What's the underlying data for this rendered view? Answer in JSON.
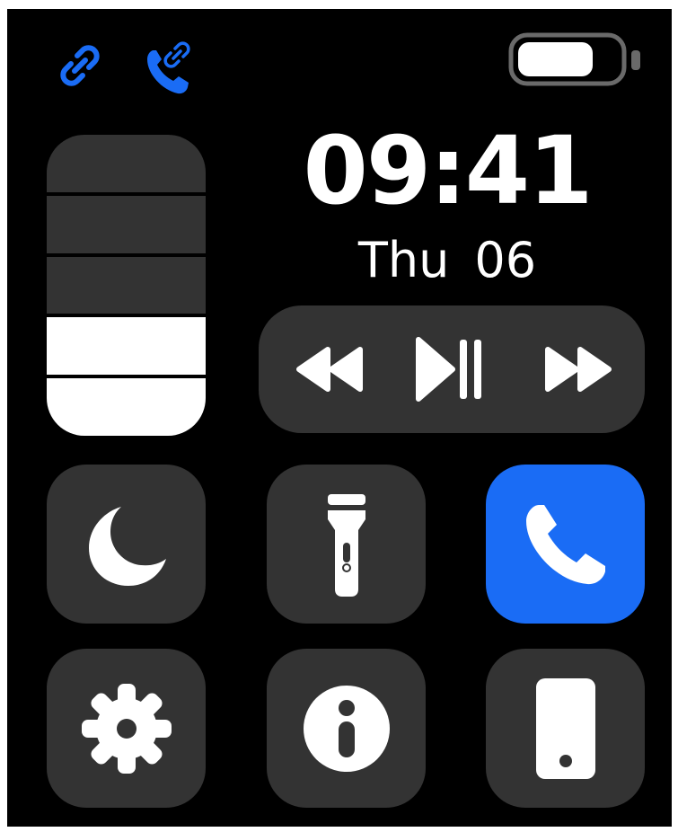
{
  "colors": {
    "background": "#000000",
    "surface": "#333333",
    "accent_blue": "#1a6cf5",
    "icon_white": "#ffffff",
    "battery_dim": "#6a6a6a"
  },
  "status_bar": {
    "left_icons": [
      "link-icon",
      "call-link-icon"
    ],
    "right_icon": "battery-icon",
    "battery_level": 0.75
  },
  "brightness": {
    "segments_total": 5,
    "segments_active": 2,
    "level": 0.4
  },
  "clock": {
    "time": "09:41",
    "day": "Thu",
    "date": "06"
  },
  "media_controls": {
    "buttons": [
      "rewind-icon",
      "play-pause-icon",
      "fast-forward-icon"
    ]
  },
  "quick_tiles": [
    {
      "icon": "moon-icon",
      "active": false
    },
    {
      "icon": "flashlight-icon",
      "active": false
    },
    {
      "icon": "phone-icon",
      "active": true
    },
    {
      "icon": "gear-icon",
      "active": false
    },
    {
      "icon": "info-icon",
      "active": false
    },
    {
      "icon": "mobile-device-icon",
      "active": false
    }
  ]
}
